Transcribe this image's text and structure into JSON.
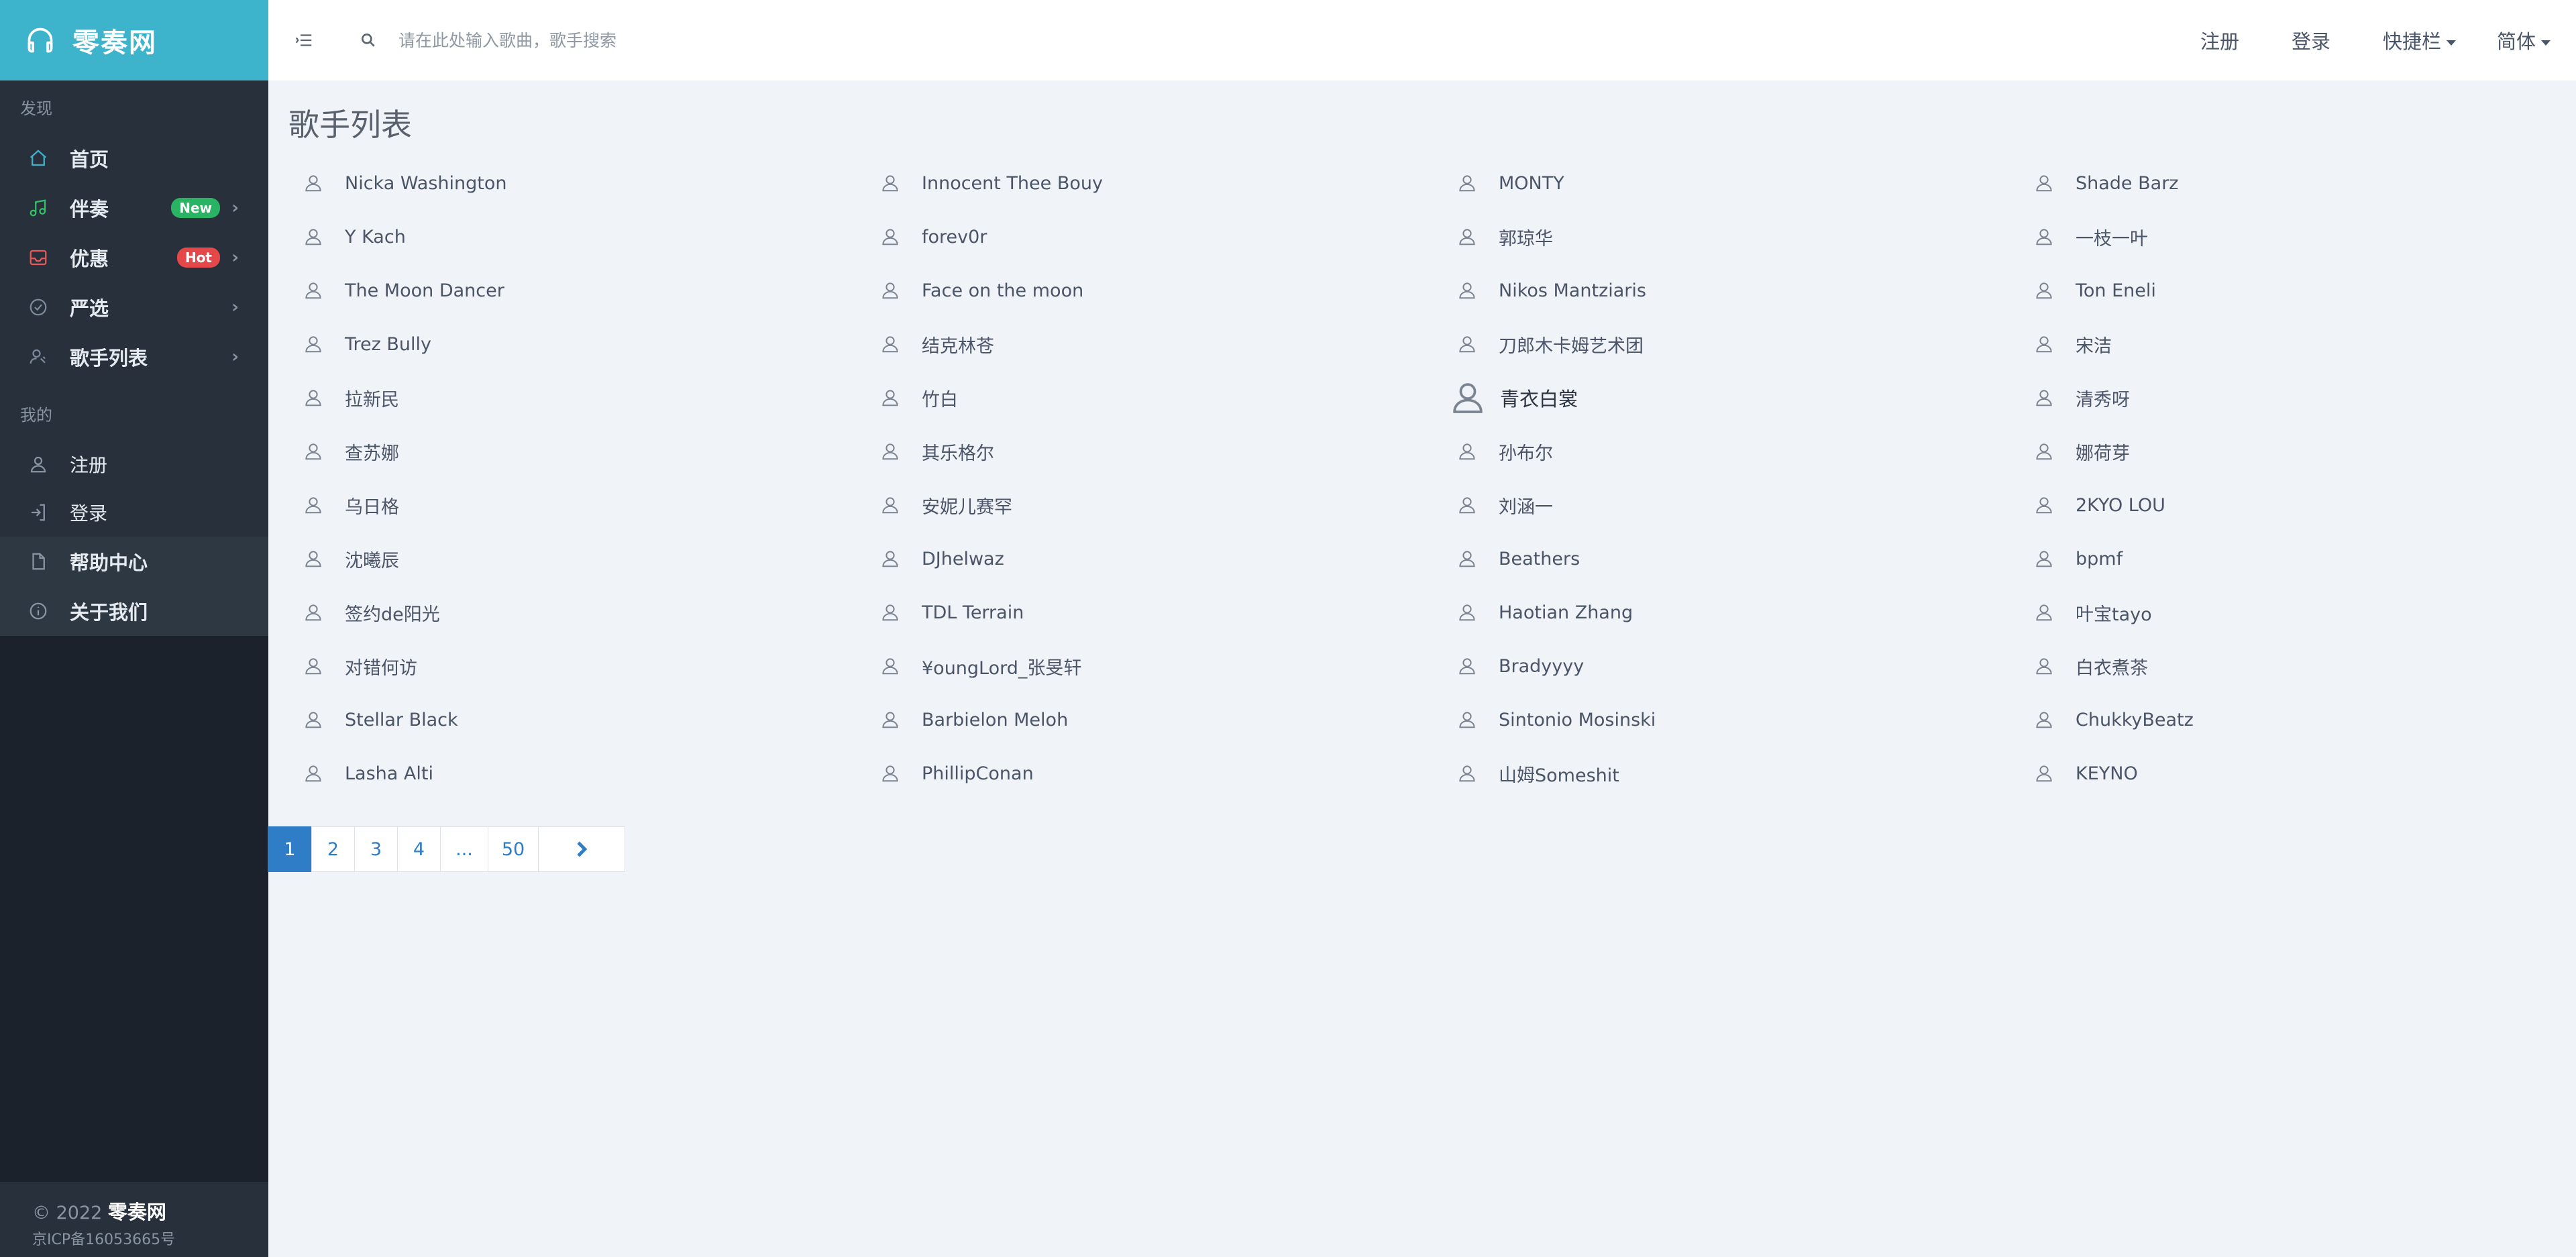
{
  "brand": {
    "name": "零奏网"
  },
  "sidebar": {
    "discover_header": "发现",
    "items": [
      {
        "label": "首页",
        "icon": "home-icon",
        "color": "#3eb4cc"
      },
      {
        "label": "伴奏",
        "icon": "music-note-icon",
        "color": "#35c06a",
        "badge": "New",
        "badge_color": "#28b463"
      },
      {
        "label": "优惠",
        "icon": "inbox-icon",
        "color": "#e85a5a",
        "badge": "Hot",
        "badge_color": "#e54848"
      },
      {
        "label": "严选",
        "icon": "check-circle-icon",
        "color": "#7d8a99"
      },
      {
        "label": "歌手列表",
        "icon": "singer-icon",
        "color": "#7d8a99"
      }
    ],
    "mine_header": "我的",
    "mine_items": [
      {
        "label": "注册",
        "icon": "user-icon"
      },
      {
        "label": "登录",
        "icon": "login-icon"
      }
    ],
    "extra_items": [
      {
        "label": "帮助中心",
        "icon": "document-icon"
      },
      {
        "label": "关于我们",
        "icon": "info-icon"
      }
    ],
    "footer": {
      "copyright": "© 2022",
      "brand": "零奏网",
      "icp": "京ICP备16053665号"
    }
  },
  "topbar": {
    "search_placeholder": "请在此处输入歌曲，歌手搜索",
    "register": "注册",
    "login": "登录",
    "shortcuts": "快捷栏",
    "language": "简体"
  },
  "page_title": "歌手列表",
  "artists": [
    [
      "Nicka Washington",
      "Innocent Thee Bouy",
      "MONTY",
      "Shade Barz"
    ],
    [
      "Y Kach",
      "forev0r",
      "郭琼华",
      "一枝一叶"
    ],
    [
      "The Moon Dancer",
      "Face on the moon",
      "Nikos Mantziaris",
      "Ton Eneli"
    ],
    [
      "Trez Bully",
      "结克林苍",
      "刀郎木卡姆艺术团",
      "宋洁"
    ],
    [
      "拉新民",
      "竹白",
      "青衣白裳",
      "清秀呀"
    ],
    [
      "查苏娜",
      "其乐格尔",
      "孙布尔",
      "娜荷芽"
    ],
    [
      "乌日格",
      "安妮儿赛罕",
      "刘涵一",
      "2KYO LOU"
    ],
    [
      "沈曦辰",
      "DJhelwaz",
      "Beathers",
      "bpmf"
    ],
    [
      "签约de阳光",
      "TDL Terrain",
      "Haotian Zhang",
      "叶宝tayo"
    ],
    [
      "对错何访",
      "¥oungLord_张旻轩",
      "Bradyyyy",
      "白衣煮茶"
    ],
    [
      "Stellar Black",
      "Barbielon Meloh",
      "Sintonio Mosinski",
      "ChukkyBeatz"
    ],
    [
      "Lasha Alti",
      "PhillipConan",
      "山姆Someshit",
      "KEYNO"
    ]
  ],
  "pagination": {
    "pages": [
      "1",
      "2",
      "3",
      "4",
      "...",
      "50"
    ],
    "active": "1",
    "next_icon": "chevron-right-icon"
  }
}
